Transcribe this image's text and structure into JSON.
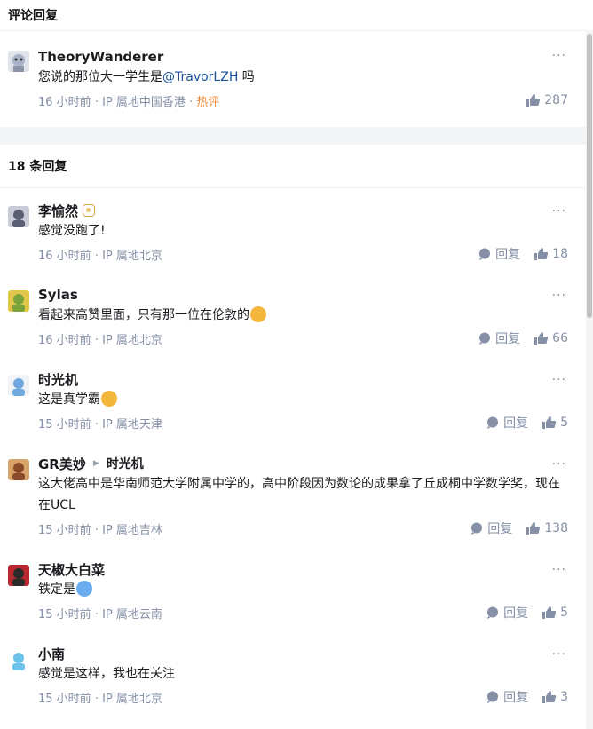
{
  "top_section": {
    "title": "评论回复"
  },
  "root_comment": {
    "author": "TheoryWanderer",
    "text_before": "您说的那位大一学生是",
    "mention": "@TravorLZH",
    "text_after": " 吗",
    "time": "16 小时前 · IP 属地中国香港 · ",
    "hot": "热评",
    "likes": "287"
  },
  "replies_section": {
    "title": "18 条回复"
  },
  "reply_label": "回复",
  "replies": [
    {
      "author": "李愉然",
      "text": "感觉没跑了!",
      "meta": "16 小时前 · IP 属地北京",
      "likes": "18"
    },
    {
      "author": "Sylas",
      "text": "看起来高赞里面，只有那一位在伦敦的",
      "meta": "16 小时前 · IP 属地北京",
      "likes": "66"
    },
    {
      "author": "时光机",
      "text": "这是真学霸",
      "meta": "15 小时前 · IP 属地天津",
      "likes": "5"
    },
    {
      "author": "GR美妙",
      "reply_to": "时光机",
      "text": "这大佬高中是华南师范大学附属中学的，高中阶段因为数论的成果拿了丘成桐中学数学奖，现在在UCL",
      "meta": "15 小时前 · IP 属地吉林",
      "likes": "138"
    },
    {
      "author": "天椒大白菜",
      "text": "铁定是",
      "meta": "15 小时前 · IP 属地云南",
      "likes": "5"
    },
    {
      "author": "小南",
      "text": "感觉是这样，我也在关注",
      "meta": "15 小时前 · IP 属地北京",
      "likes": "3"
    }
  ],
  "more_glyph": "···"
}
